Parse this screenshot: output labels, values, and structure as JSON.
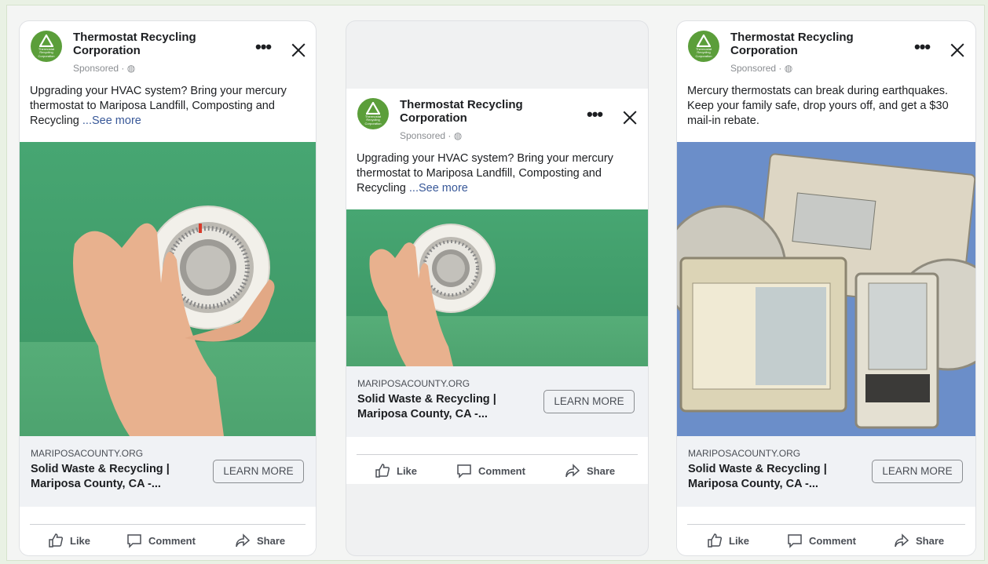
{
  "ads": [
    {
      "advertiser": "Thermostat Recycling Corporation",
      "sponsored": "Sponsored · ◍",
      "logo_text": "Thermostat Recycling Corporation",
      "body": "Upgrading your HVAC system? Bring your mercury thermostat to Mariposa Landfill, Composting and Recycling",
      "see_more": "...See more",
      "image": "hand-turning-round-thermostat-on-green",
      "domain": "MARIPOSACOUNTY.ORG",
      "link_title": "Solid Waste & Recycling | Mariposa County, CA -...",
      "cta": "LEARN MORE",
      "actions": {
        "like": "Like",
        "comment": "Comment",
        "share": "Share"
      }
    },
    {
      "advertiser": "Thermostat Recycling Corporation",
      "sponsored": "Sponsored · ◍",
      "logo_text": "Thermostat Recycling Corporation",
      "body": "Upgrading your HVAC system? Bring your mercury thermostat to Mariposa Landfill, Composting and Recycling",
      "see_more": "...See more",
      "image": "hand-turning-round-thermostat-on-green",
      "domain": "MARIPOSACOUNTY.ORG",
      "link_title": "Solid Waste & Recycling | Mariposa County, CA -...",
      "cta": "LEARN MORE",
      "actions": {
        "like": "Like",
        "comment": "Comment",
        "share": "Share"
      }
    },
    {
      "advertiser": "Thermostat Recycling Corporation",
      "sponsored": "Sponsored · ◍",
      "logo_text": "Thermostat Recycling Corporation",
      "body": "Mercury thermostats can break during earthquakes. Keep your family safe, drop yours off, and get a $30 mail-in rebate.",
      "see_more": "",
      "image": "pile-of-old-mercury-thermostats-on-blue",
      "domain": "MARIPOSACOUNTY.ORG",
      "link_title": "Solid Waste & Recycling | Mariposa County, CA -...",
      "cta": "LEARN MORE",
      "actions": {
        "like": "Like",
        "comment": "Comment",
        "share": "Share"
      }
    }
  ],
  "colors": {
    "link_blue": "#385898",
    "logo_green": "#5b9e3a",
    "photo_green": "#47a672",
    "photo_blue": "#6b8ec9"
  }
}
